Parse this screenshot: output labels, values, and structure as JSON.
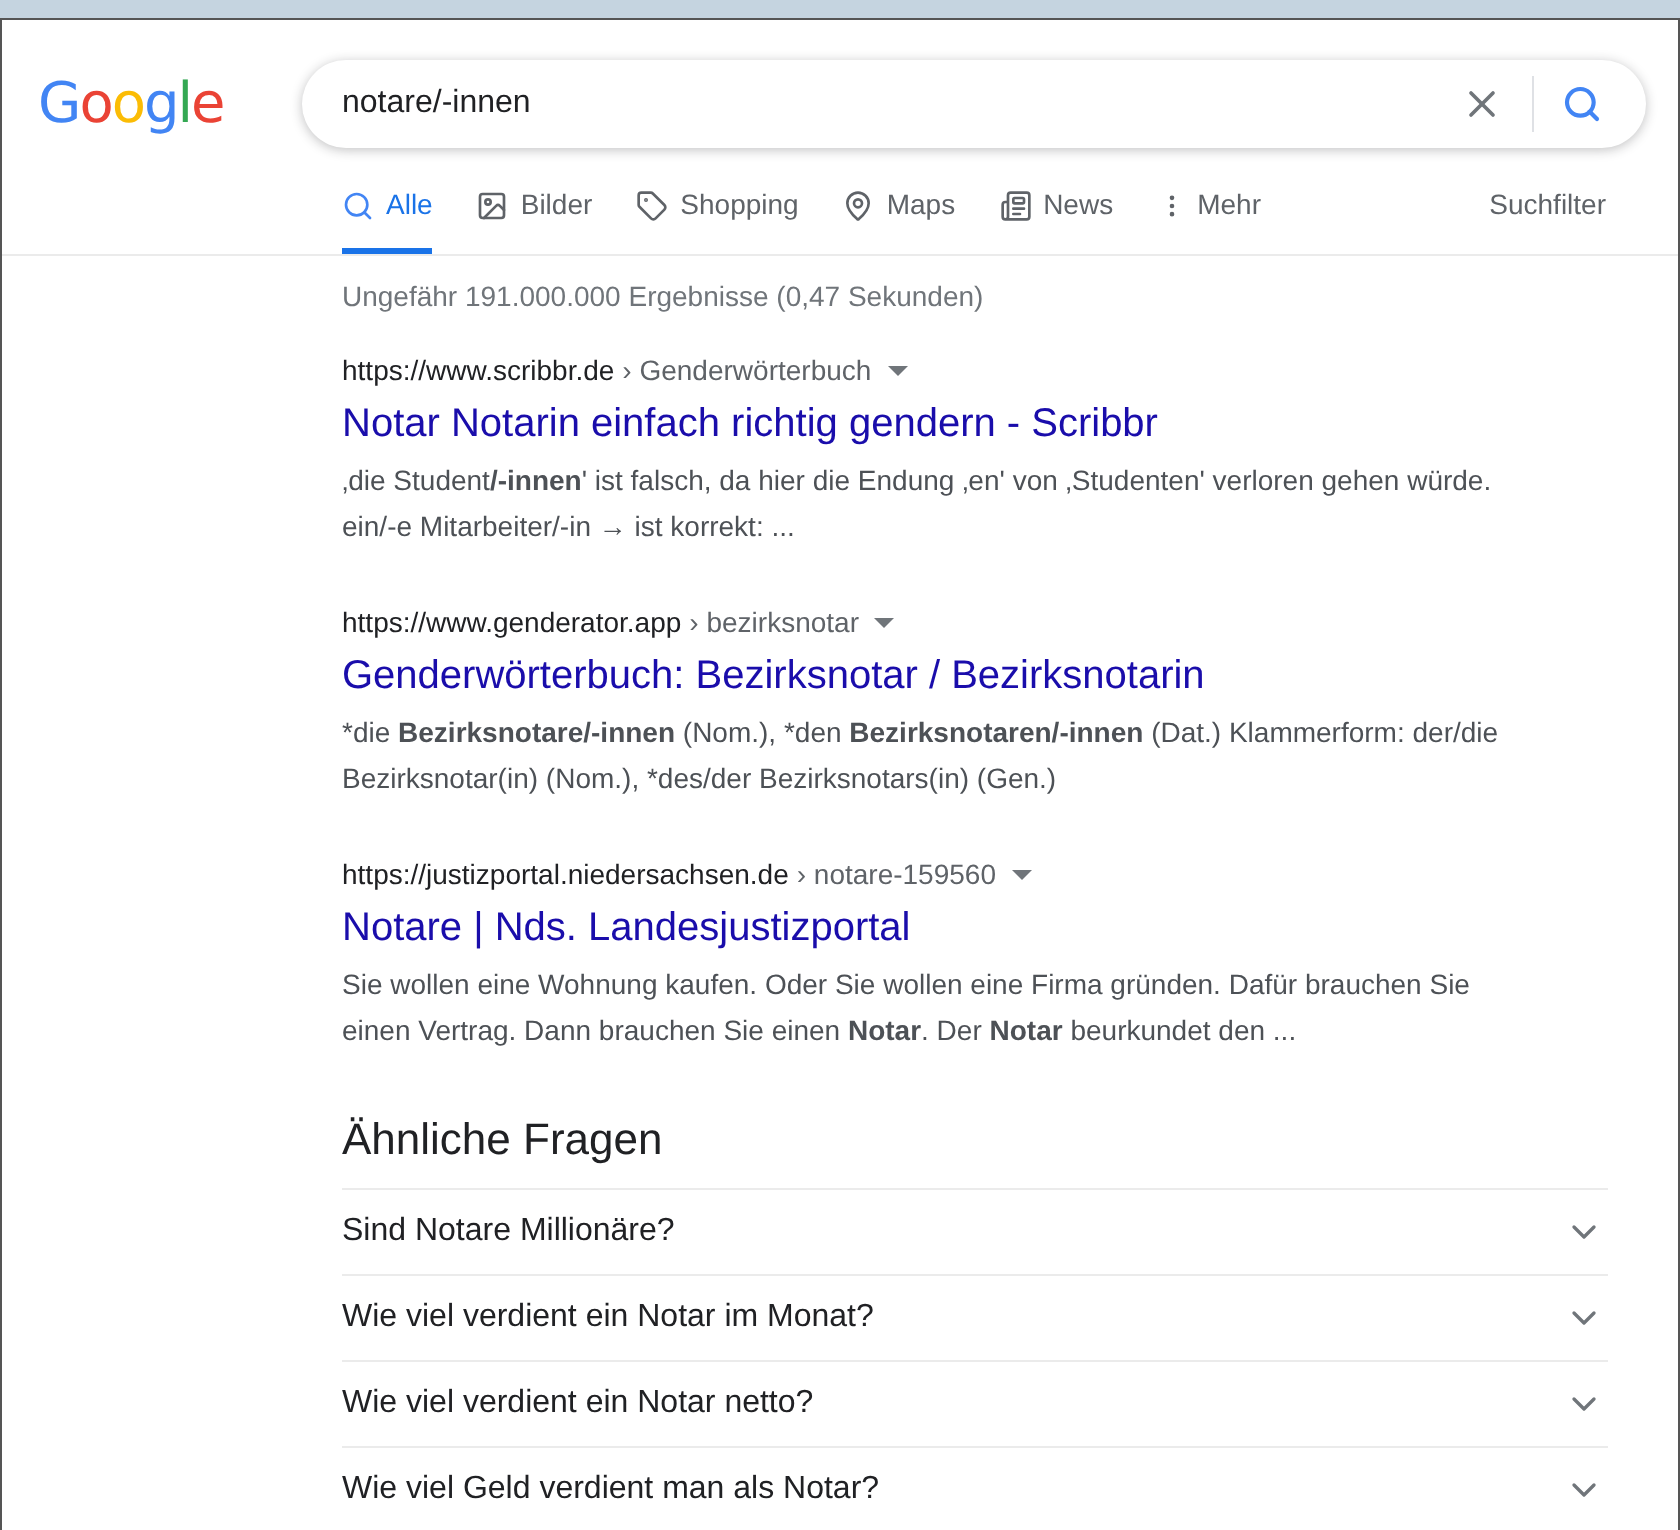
{
  "logo": "Google",
  "search": {
    "value": "notare/-innen"
  },
  "tabs": [
    {
      "label": "Alle",
      "kind": "search",
      "selected": true
    },
    {
      "label": "Bilder",
      "kind": "image",
      "selected": false
    },
    {
      "label": "Shopping",
      "kind": "tag",
      "selected": false
    },
    {
      "label": "Maps",
      "kind": "pin",
      "selected": false
    },
    {
      "label": "News",
      "kind": "news",
      "selected": false
    },
    {
      "label": "Mehr",
      "kind": "more",
      "selected": false
    }
  ],
  "filter_button": "Suchfilter",
  "result_stats": "Ungefähr 191.000.000 Ergebnisse (0,47 Sekunden)",
  "results": [
    {
      "url": "https://www.scribbr.de",
      "breadcrumb": "› Genderwörterbuch",
      "title": "Notar Notarin einfach richtig gendern - Scribbr",
      "snippet": "‚die Student**/-innen**' ist falsch, da hier die Endung ‚en' von ‚Studenten' verloren gehen würde. ein/-e Mitarbeiter/-in → ist korrekt: ..."
    },
    {
      "url": "https://www.genderator.app",
      "breadcrumb": "› bezirksnotar",
      "title": "Genderwörterbuch: Bezirksnotar / Bezirksnotarin",
      "snippet": "*die **Bezirksnotare/-innen** (Nom.), *den **Bezirksnotaren/-innen** (Dat.) Klammerform: der/die Bezirksnotar(in) (Nom.), *des/der Bezirksnotars(in) (Gen.)"
    },
    {
      "url": "https://justizportal.niedersachsen.de",
      "breadcrumb": "› notare-159560",
      "title": "Notare | Nds. Landesjustizportal",
      "snippet": "Sie wollen eine Wohnung kaufen. Oder Sie wollen eine Firma gründen. Dafür brauchen Sie einen Vertrag. Dann brauchen Sie einen **Notar**. Der **Notar** beurkundet den ..."
    }
  ],
  "related_questions": {
    "title": "Ähnliche Fragen",
    "items": [
      {
        "question": "Sind Notare Millionäre?",
        "expanded": false
      },
      {
        "question": "Wie viel verdient ein Notar im Monat?",
        "expanded": false
      },
      {
        "question": "Wie viel verdient ein Notar netto?",
        "expanded": false
      },
      {
        "question": "Wie viel Geld verdient man als Notar?",
        "expanded": false
      }
    ]
  }
}
